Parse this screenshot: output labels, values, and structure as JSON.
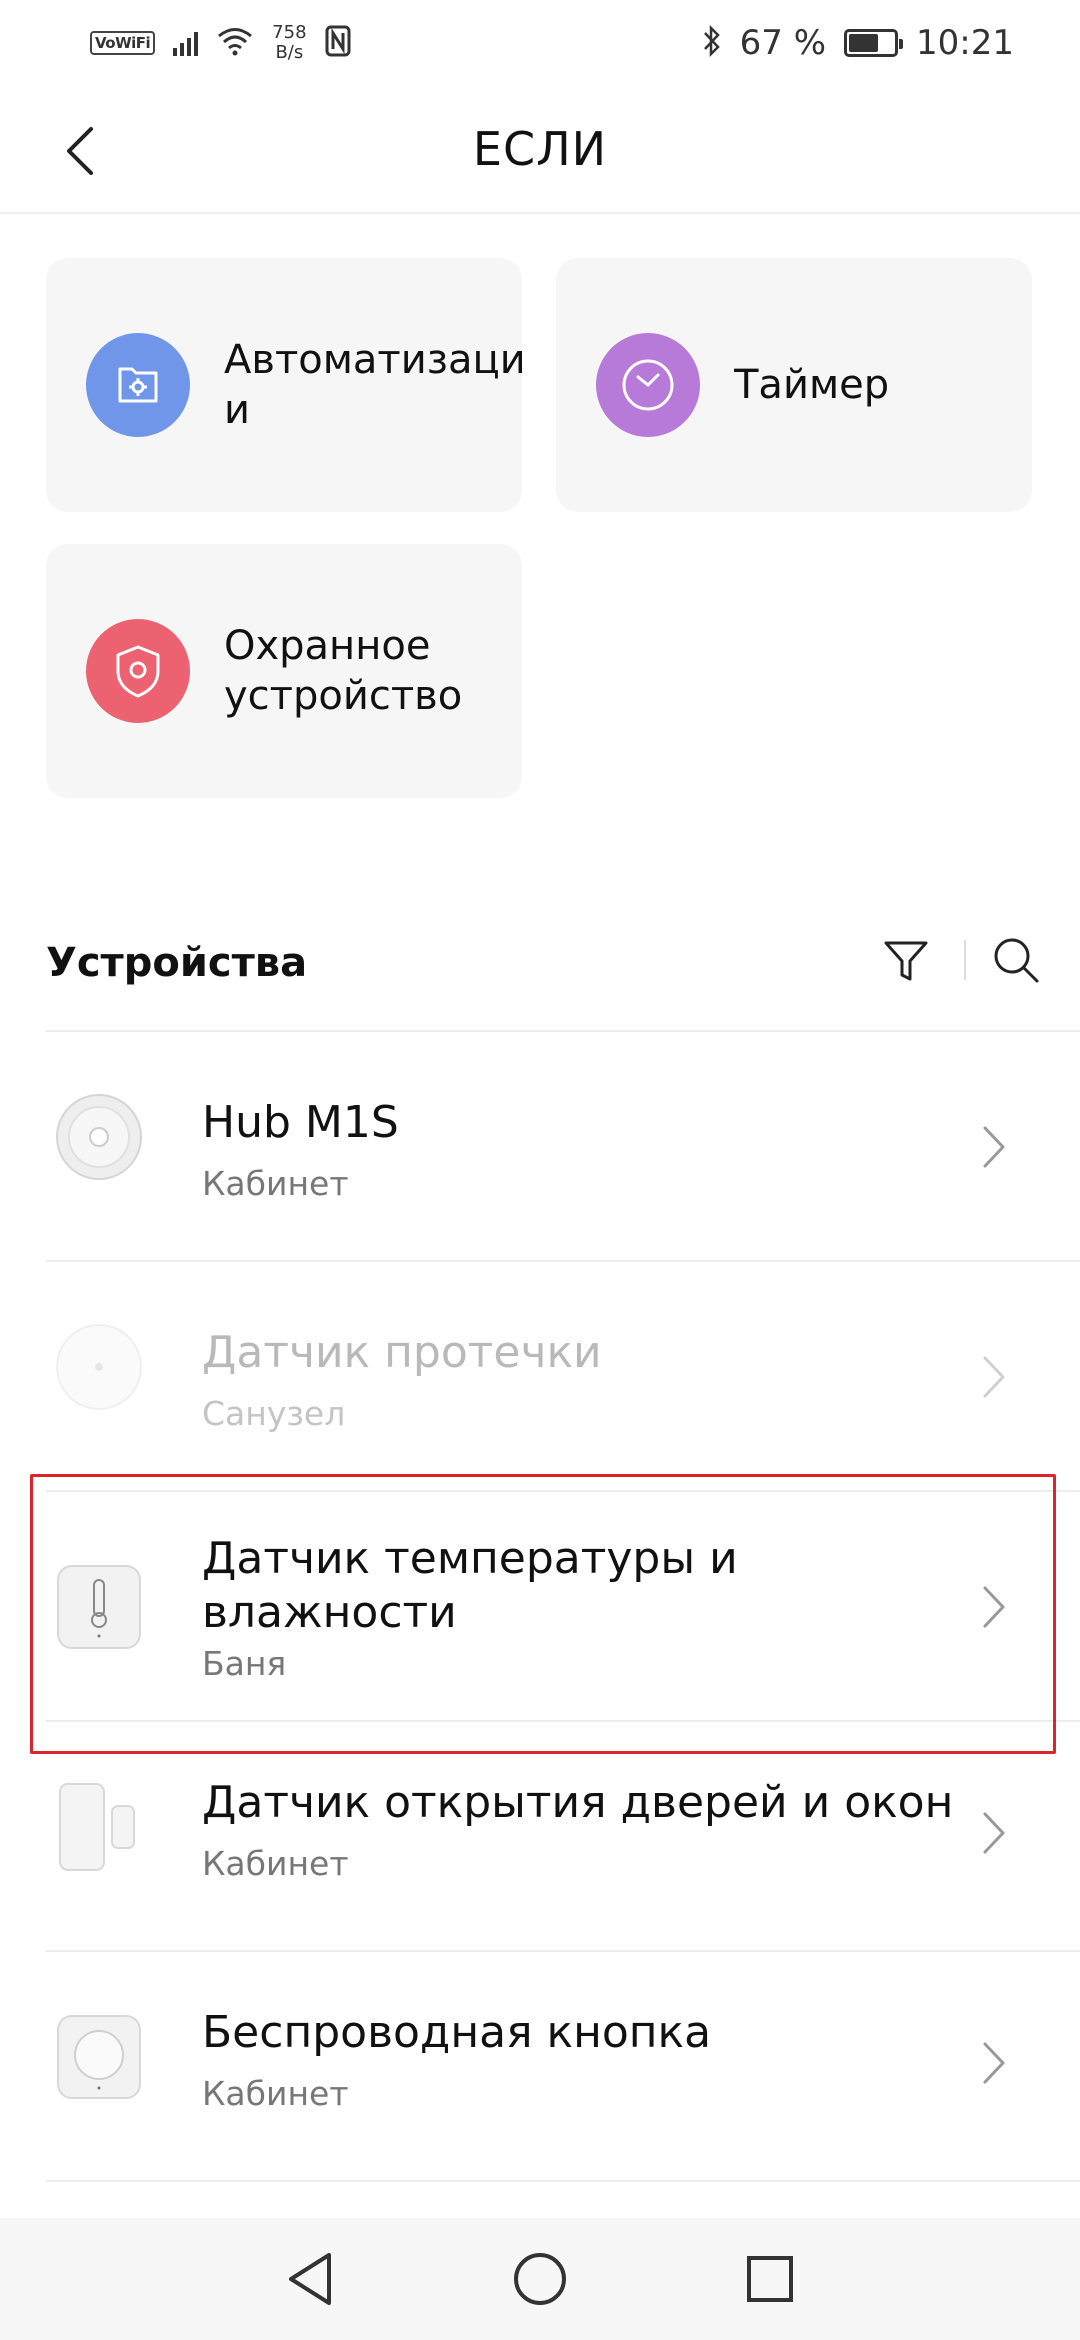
{
  "status_bar": {
    "vowifi": "VoWiFi",
    "net_speed_value": "758",
    "net_speed_unit": "B/s",
    "battery_percent": "67 %",
    "battery_level": 0.67,
    "time": "10:21"
  },
  "header": {
    "title": "ЕСЛИ"
  },
  "conditions": [
    {
      "label": "Автоматизаци\nи",
      "icon": "folder-gear-icon",
      "color": "#6f96e8"
    },
    {
      "label": "Таймер",
      "icon": "clock-icon",
      "color": "#b87ad8"
    },
    {
      "label": "Охранное\nустройство",
      "icon": "shield-icon",
      "color": "#ec6270"
    }
  ],
  "devices_section": {
    "title": "Устройства",
    "filter_icon": "filter-icon",
    "search_icon": "search-icon"
  },
  "devices": [
    {
      "name": "Hub M1S",
      "room": "Кабинет",
      "icon": "hub-icon",
      "enabled": true
    },
    {
      "name": "Датчик протечки",
      "room": "Санузел",
      "icon": "leak-sensor-icon",
      "enabled": false
    },
    {
      "name": "Датчик температуры и влажности",
      "room": "Баня",
      "icon": "thermometer-icon",
      "enabled": true,
      "highlighted": true
    },
    {
      "name": "Датчик открытия дверей и окон",
      "room": "Кабинет",
      "icon": "door-sensor-icon",
      "enabled": true
    },
    {
      "name": "Беспроводная кнопка",
      "room": "Кабинет",
      "icon": "wireless-button-icon",
      "enabled": true
    }
  ],
  "colors": {
    "highlight": "#d9252b",
    "card_bg": "#f6f6f6",
    "disabled_text": "#b9b9b9"
  }
}
